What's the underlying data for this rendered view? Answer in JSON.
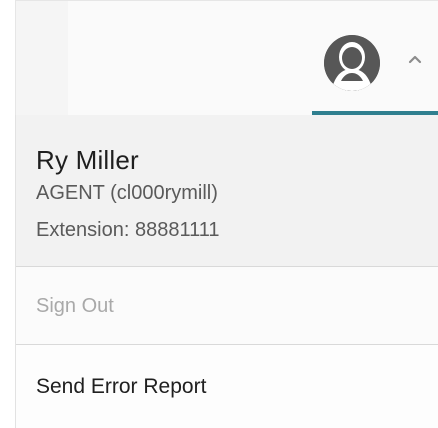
{
  "header": {
    "avatar_icon": "user-silhouette-icon",
    "menu_toggle_icon": "chevron-up-icon",
    "accent_color": "#2f7f8f"
  },
  "profile": {
    "name": "Ry Miller",
    "role_line": "AGENT (cl000rymill)",
    "extension_line": "Extension: 88881111"
  },
  "menu": {
    "sign_out_label": "Sign Out",
    "send_error_report_label": "Send Error Report"
  }
}
